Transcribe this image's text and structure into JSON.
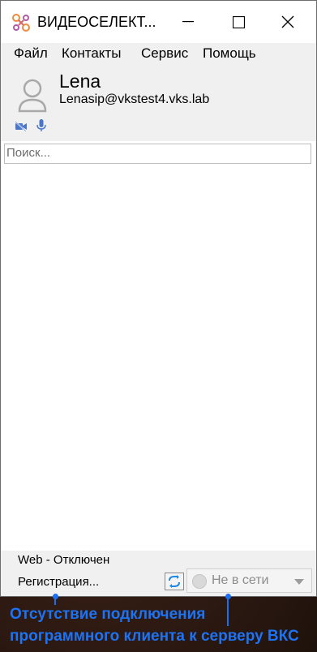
{
  "window": {
    "title": "ВИДЕОСЕЛЕКТ..."
  },
  "menu": {
    "items": [
      "Файл",
      "Контакты",
      "Сервис",
      "Помощь"
    ]
  },
  "profile": {
    "name": "Lena",
    "email": "Lenasip@vkstest4.vks.lab"
  },
  "search": {
    "placeholder": "Поиск..."
  },
  "status": {
    "web": "Web - Отключен",
    "registration": "Регистрация...",
    "presence": "Не в сети"
  },
  "annotation": {
    "line1": "Отсутствие подключения",
    "line2": "программного клиента к серверу ВКС"
  },
  "colors": {
    "annotation_blue": "#1d73f5",
    "app_icon_orange": "#f08a3c",
    "app_icon_purple": "#b05aa8",
    "refresh_blue": "#1e88e5"
  },
  "icons": {
    "app": "videoselect-logo-icon",
    "avatar": "user-avatar-icon",
    "camera": "camera-off-icon",
    "mic": "microphone-icon",
    "refresh": "refresh-icon"
  }
}
